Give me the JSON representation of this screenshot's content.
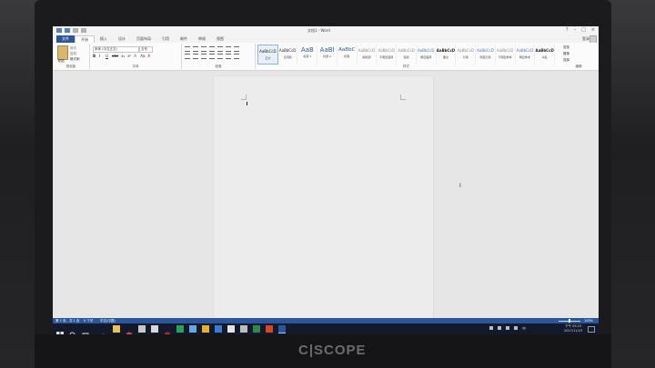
{
  "monitor": {
    "brand": "C|SCOPE"
  },
  "word": {
    "doc_title": "文档1 - Word",
    "window_controls": [
      "?",
      "–",
      "□",
      "×"
    ],
    "tabs": [
      "文件",
      "开始",
      "插入",
      "设计",
      "页面布局",
      "引用",
      "邮件",
      "审阅",
      "视图"
    ],
    "active_tab": "开始",
    "user": "登录",
    "clipboard": {
      "paste": "粘贴",
      "cut": "剪切",
      "copy": "复制",
      "format_painter": "格式刷",
      "label": "剪贴板"
    },
    "font": {
      "name": "宋体 (中文正文)",
      "size": "五号",
      "label": "字体",
      "format_buttons": [
        "B",
        "I",
        "U",
        "abc",
        "x₂",
        "x²",
        "A",
        "Aa",
        "A"
      ]
    },
    "paragraph": {
      "label": "段落"
    },
    "styles": {
      "label": "样式",
      "items": [
        {
          "sample": "AaBbCcD",
          "name": "正文"
        },
        {
          "sample": "AaBbCcD",
          "name": "无间隔"
        },
        {
          "sample": "AaB",
          "name": "标题 1"
        },
        {
          "sample": "AaBl",
          "name": "标题 2"
        },
        {
          "sample": "AaBbC",
          "name": "标题"
        },
        {
          "sample": "AaBbCcD",
          "name": "副标题"
        },
        {
          "sample": "AaBbCcD",
          "name": "不明显强调"
        },
        {
          "sample": "AaBbCcD",
          "name": "强调"
        },
        {
          "sample": "AaBbCcD",
          "name": "明显强调"
        },
        {
          "sample": "AaBbCcD",
          "name": "要点"
        },
        {
          "sample": "AaBbCcD",
          "name": "引用"
        },
        {
          "sample": "AaBbCcD",
          "name": "明显引用"
        },
        {
          "sample": "AaBbCcD",
          "name": "不明显参考"
        },
        {
          "sample": "AaBbCcD",
          "name": "明显参考"
        },
        {
          "sample": "AaBbCcD",
          "name": "书名"
        }
      ]
    },
    "editing": {
      "label": "编辑",
      "find": "查找",
      "replace": "替换",
      "select": "选择"
    },
    "status": {
      "page": "第 1 页，共 1 页",
      "words": "0 个字",
      "lang": "中文(中国)",
      "zoom": "100%"
    }
  },
  "taskbar": {
    "time": "下午 05:23",
    "date": "2017/11/23",
    "lang": "中"
  },
  "colors": {
    "word_blue": "#2b579a",
    "taskbar": "#121a2b"
  }
}
